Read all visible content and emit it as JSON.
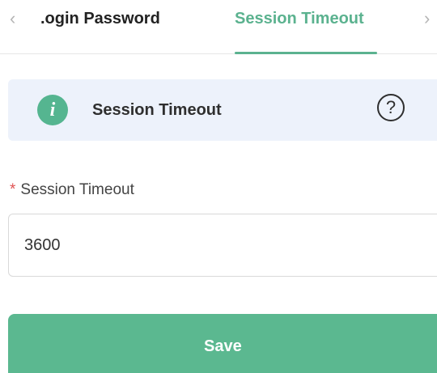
{
  "tabs": {
    "items": [
      {
        "label": ".ogin Password",
        "active": false
      },
      {
        "label": "Session Timeout",
        "active": true
      }
    ],
    "prev_icon": "chevron-left-icon",
    "next_icon": "chevron-right-icon",
    "prev_glyph": "‹",
    "next_glyph": "›"
  },
  "info_banner": {
    "icon": "info-icon",
    "icon_glyph": "i",
    "title": "Session Timeout",
    "help_icon": "question-circle-icon",
    "help_glyph": "?"
  },
  "form": {
    "session_timeout": {
      "required_mark": "*",
      "label": "Session Timeout",
      "value": "3600"
    },
    "save_label": "Save"
  },
  "colors": {
    "accent": "#5bb28f",
    "banner_bg": "#edf2fb",
    "required": "#e05353"
  }
}
